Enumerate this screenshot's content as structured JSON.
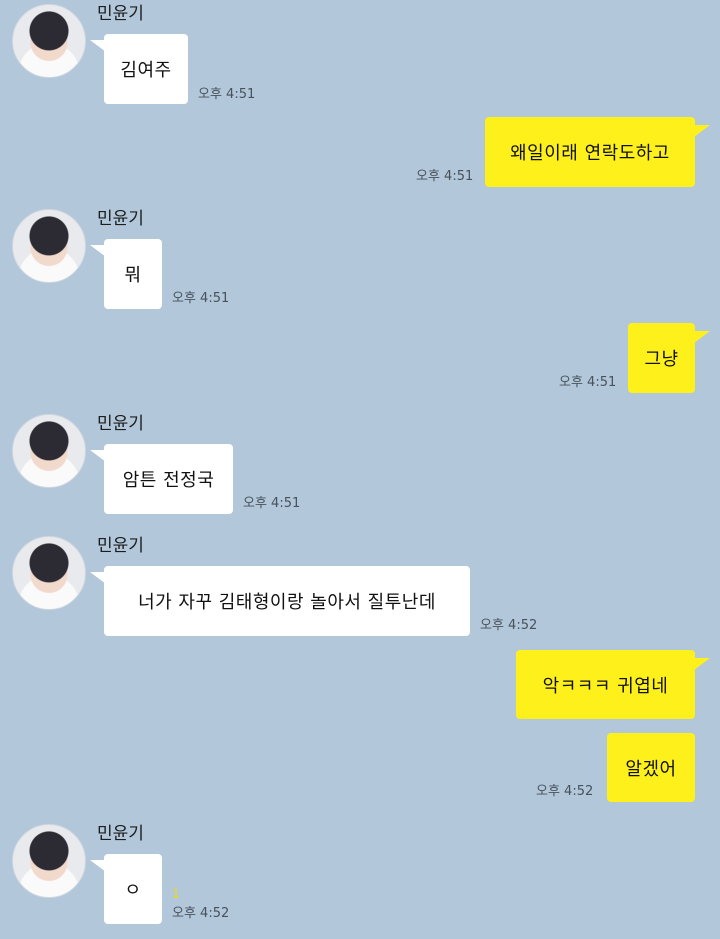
{
  "contact": {
    "name": "민윤기"
  },
  "messages": [
    {
      "from": "them",
      "text": "김여주",
      "time": "오후 4:51"
    },
    {
      "from": "me",
      "text": "왜일이래 연락도하고",
      "time": "오후 4:51"
    },
    {
      "from": "them",
      "text": "뭐",
      "time": "오후 4:51"
    },
    {
      "from": "me",
      "text": "그냥",
      "time": "오후 4:51"
    },
    {
      "from": "them",
      "text": "암튼 전정국",
      "time": "오후 4:51"
    },
    {
      "from": "them",
      "text": "너가 자꾸 김태형이랑 놀아서 질투난데",
      "time": "오후 4:52"
    },
    {
      "from": "me",
      "text": "악ㅋㅋㅋ 귀엽네",
      "time": ""
    },
    {
      "from": "me",
      "text": "알겠어",
      "time": "오후 4:52"
    },
    {
      "from": "them",
      "text": "ㅇ",
      "time": "오후 4:52",
      "unread": "1"
    }
  ],
  "colors": {
    "background": "#b2c7da",
    "my_bubble": "#fef01b",
    "their_bubble": "#ffffff",
    "time_text": "#47525c"
  }
}
